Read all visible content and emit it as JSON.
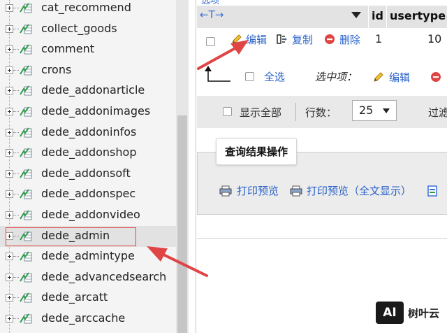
{
  "tree": {
    "tables": [
      {
        "name": "cat_recommend"
      },
      {
        "name": "collect_goods"
      },
      {
        "name": "comment"
      },
      {
        "name": "crons"
      },
      {
        "name": "dede_addonarticle"
      },
      {
        "name": "dede_addonimages"
      },
      {
        "name": "dede_addoninfos"
      },
      {
        "name": "dede_addonshop"
      },
      {
        "name": "dede_addonsoft"
      },
      {
        "name": "dede_addonspec"
      },
      {
        "name": "dede_addonvideo"
      },
      {
        "name": "dede_admin"
      },
      {
        "name": "dede_admintype"
      },
      {
        "name": "dede_advancedsearch"
      },
      {
        "name": "dede_arcatt"
      },
      {
        "name": "dede_arccache"
      }
    ],
    "selected": "dede_admin"
  },
  "results": {
    "top_cut_text": "选项",
    "header": {
      "sort_arrows": "←T→",
      "col_id": "id",
      "col_usertype": "usertype"
    },
    "row": {
      "edit": "编辑",
      "copy": "复制",
      "delete": "删除",
      "id": "1",
      "usertype": "10"
    },
    "bulk": {
      "select_all": "全选",
      "with_selected": "选中项：",
      "edit": "编辑"
    },
    "toolbar": {
      "show_all": "显示全部",
      "rows_label": "行数：",
      "rows_value": "25",
      "filter_label": "过滤"
    },
    "ops": {
      "legend": "查询结果操作",
      "print_preview": "打印预览",
      "print_preview_full": "打印预览（全文显示）"
    }
  },
  "watermark": {
    "logo": "AI",
    "text": "树叶云"
  },
  "colors": {
    "link": "#2962c9",
    "annotation_red": "#e04545",
    "tree_bg": "#f4f4f4"
  }
}
